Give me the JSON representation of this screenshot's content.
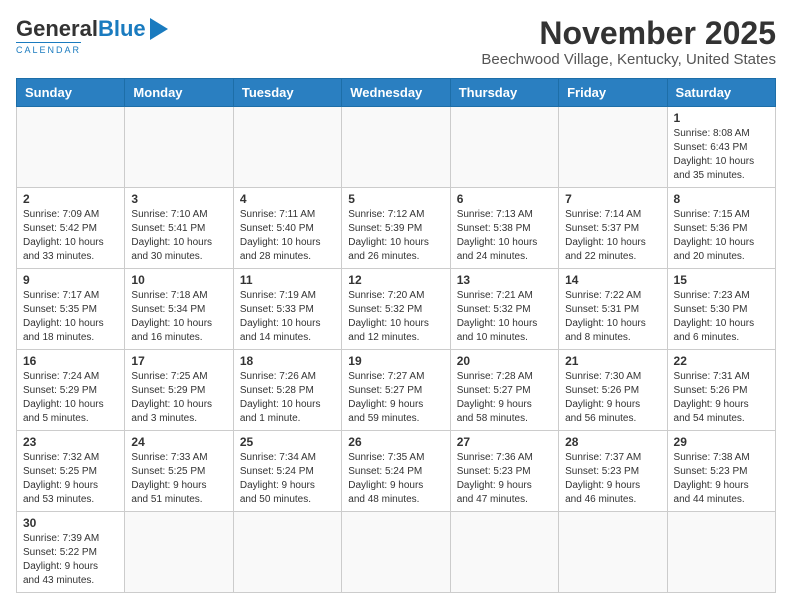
{
  "header": {
    "logo_general": "General",
    "logo_blue": "Blue",
    "month_title": "November 2025",
    "location": "Beechwood Village, Kentucky, United States"
  },
  "weekdays": [
    "Sunday",
    "Monday",
    "Tuesday",
    "Wednesday",
    "Thursday",
    "Friday",
    "Saturday"
  ],
  "weeks": [
    [
      {
        "day": "",
        "info": ""
      },
      {
        "day": "",
        "info": ""
      },
      {
        "day": "",
        "info": ""
      },
      {
        "day": "",
        "info": ""
      },
      {
        "day": "",
        "info": ""
      },
      {
        "day": "",
        "info": ""
      },
      {
        "day": "1",
        "info": "Sunrise: 8:08 AM\nSunset: 6:43 PM\nDaylight: 10 hours\nand 35 minutes."
      }
    ],
    [
      {
        "day": "2",
        "info": "Sunrise: 7:09 AM\nSunset: 5:42 PM\nDaylight: 10 hours\nand 33 minutes."
      },
      {
        "day": "3",
        "info": "Sunrise: 7:10 AM\nSunset: 5:41 PM\nDaylight: 10 hours\nand 30 minutes."
      },
      {
        "day": "4",
        "info": "Sunrise: 7:11 AM\nSunset: 5:40 PM\nDaylight: 10 hours\nand 28 minutes."
      },
      {
        "day": "5",
        "info": "Sunrise: 7:12 AM\nSunset: 5:39 PM\nDaylight: 10 hours\nand 26 minutes."
      },
      {
        "day": "6",
        "info": "Sunrise: 7:13 AM\nSunset: 5:38 PM\nDaylight: 10 hours\nand 24 minutes."
      },
      {
        "day": "7",
        "info": "Sunrise: 7:14 AM\nSunset: 5:37 PM\nDaylight: 10 hours\nand 22 minutes."
      },
      {
        "day": "8",
        "info": "Sunrise: 7:15 AM\nSunset: 5:36 PM\nDaylight: 10 hours\nand 20 minutes."
      }
    ],
    [
      {
        "day": "9",
        "info": "Sunrise: 7:17 AM\nSunset: 5:35 PM\nDaylight: 10 hours\nand 18 minutes."
      },
      {
        "day": "10",
        "info": "Sunrise: 7:18 AM\nSunset: 5:34 PM\nDaylight: 10 hours\nand 16 minutes."
      },
      {
        "day": "11",
        "info": "Sunrise: 7:19 AM\nSunset: 5:33 PM\nDaylight: 10 hours\nand 14 minutes."
      },
      {
        "day": "12",
        "info": "Sunrise: 7:20 AM\nSunset: 5:32 PM\nDaylight: 10 hours\nand 12 minutes."
      },
      {
        "day": "13",
        "info": "Sunrise: 7:21 AM\nSunset: 5:32 PM\nDaylight: 10 hours\nand 10 minutes."
      },
      {
        "day": "14",
        "info": "Sunrise: 7:22 AM\nSunset: 5:31 PM\nDaylight: 10 hours\nand 8 minutes."
      },
      {
        "day": "15",
        "info": "Sunrise: 7:23 AM\nSunset: 5:30 PM\nDaylight: 10 hours\nand 6 minutes."
      }
    ],
    [
      {
        "day": "16",
        "info": "Sunrise: 7:24 AM\nSunset: 5:29 PM\nDaylight: 10 hours\nand 5 minutes."
      },
      {
        "day": "17",
        "info": "Sunrise: 7:25 AM\nSunset: 5:29 PM\nDaylight: 10 hours\nand 3 minutes."
      },
      {
        "day": "18",
        "info": "Sunrise: 7:26 AM\nSunset: 5:28 PM\nDaylight: 10 hours\nand 1 minute."
      },
      {
        "day": "19",
        "info": "Sunrise: 7:27 AM\nSunset: 5:27 PM\nDaylight: 9 hours\nand 59 minutes."
      },
      {
        "day": "20",
        "info": "Sunrise: 7:28 AM\nSunset: 5:27 PM\nDaylight: 9 hours\nand 58 minutes."
      },
      {
        "day": "21",
        "info": "Sunrise: 7:30 AM\nSunset: 5:26 PM\nDaylight: 9 hours\nand 56 minutes."
      },
      {
        "day": "22",
        "info": "Sunrise: 7:31 AM\nSunset: 5:26 PM\nDaylight: 9 hours\nand 54 minutes."
      }
    ],
    [
      {
        "day": "23",
        "info": "Sunrise: 7:32 AM\nSunset: 5:25 PM\nDaylight: 9 hours\nand 53 minutes."
      },
      {
        "day": "24",
        "info": "Sunrise: 7:33 AM\nSunset: 5:25 PM\nDaylight: 9 hours\nand 51 minutes."
      },
      {
        "day": "25",
        "info": "Sunrise: 7:34 AM\nSunset: 5:24 PM\nDaylight: 9 hours\nand 50 minutes."
      },
      {
        "day": "26",
        "info": "Sunrise: 7:35 AM\nSunset: 5:24 PM\nDaylight: 9 hours\nand 48 minutes."
      },
      {
        "day": "27",
        "info": "Sunrise: 7:36 AM\nSunset: 5:23 PM\nDaylight: 9 hours\nand 47 minutes."
      },
      {
        "day": "28",
        "info": "Sunrise: 7:37 AM\nSunset: 5:23 PM\nDaylight: 9 hours\nand 46 minutes."
      },
      {
        "day": "29",
        "info": "Sunrise: 7:38 AM\nSunset: 5:23 PM\nDaylight: 9 hours\nand 44 minutes."
      }
    ],
    [
      {
        "day": "30",
        "info": "Sunrise: 7:39 AM\nSunset: 5:22 PM\nDaylight: 9 hours\nand 43 minutes."
      },
      {
        "day": "",
        "info": ""
      },
      {
        "day": "",
        "info": ""
      },
      {
        "day": "",
        "info": ""
      },
      {
        "day": "",
        "info": ""
      },
      {
        "day": "",
        "info": ""
      },
      {
        "day": "",
        "info": ""
      }
    ]
  ]
}
